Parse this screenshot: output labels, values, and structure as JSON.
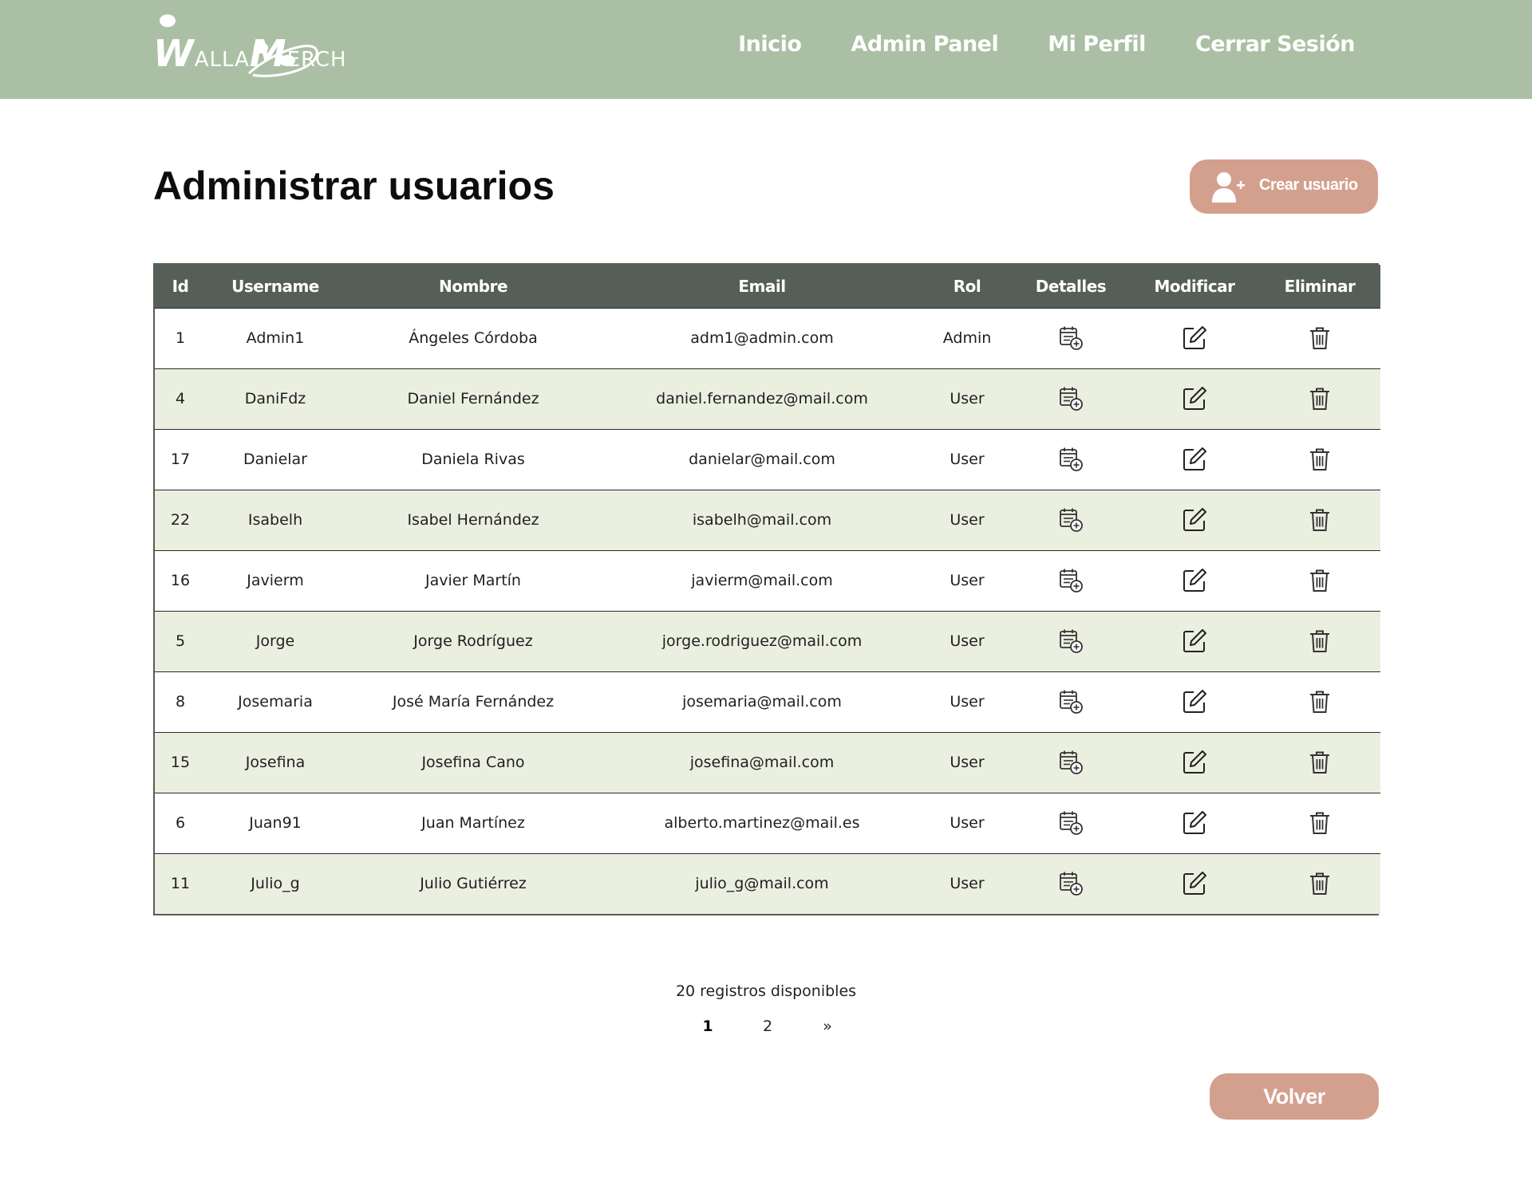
{
  "nav": {
    "logo_big_w": "W",
    "logo_alla": "ALLA",
    "logo_big_m": "M",
    "logo_erch": "ERCH",
    "links": [
      "Inicio",
      "Admin Panel",
      "Mi Perfil",
      "Cerrar Sesión"
    ]
  },
  "page": {
    "title": "Administrar usuarios",
    "create_button": "Crear usuario"
  },
  "table": {
    "headers": [
      "Id",
      "Username",
      "Nombre",
      "Email",
      "Rol",
      "Detalles",
      "Modificar",
      "Eliminar"
    ],
    "rows": [
      {
        "id": "1",
        "username": "Admin1",
        "nombre": "Ángeles Córdoba",
        "email": "adm1@admin.com",
        "rol": "Admin"
      },
      {
        "id": "4",
        "username": "DaniFdz",
        "nombre": "Daniel Fernández",
        "email": "daniel.fernandez@mail.com",
        "rol": "User"
      },
      {
        "id": "17",
        "username": "Danielar",
        "nombre": "Daniela Rivas",
        "email": "danielar@mail.com",
        "rol": "User"
      },
      {
        "id": "22",
        "username": "Isabelh",
        "nombre": "Isabel Hernández",
        "email": "isabelh@mail.com",
        "rol": "User"
      },
      {
        "id": "16",
        "username": "Javierm",
        "nombre": "Javier Martín",
        "email": "javierm@mail.com",
        "rol": "User"
      },
      {
        "id": "5",
        "username": "Jorge",
        "nombre": "Jorge Rodríguez",
        "email": "jorge.rodriguez@mail.com",
        "rol": "User"
      },
      {
        "id": "8",
        "username": "Josemaria",
        "nombre": "José María Fernández",
        "email": "josemaria@mail.com",
        "rol": "User"
      },
      {
        "id": "15",
        "username": "Josefina",
        "nombre": "Josefina Cano",
        "email": "josefina@mail.com",
        "rol": "User"
      },
      {
        "id": "6",
        "username": "Juan91",
        "nombre": "Juan Martínez",
        "email": "alberto.martinez@mail.es",
        "rol": "User"
      },
      {
        "id": "11",
        "username": "Julio_g",
        "nombre": "Julio Gutiérrez",
        "email": "julio_g@mail.com",
        "rol": "User"
      }
    ]
  },
  "footer": {
    "records_text": "20 registros disponibles",
    "pages": [
      "1",
      "2",
      "»"
    ],
    "active_page": "1",
    "back_button": "Volver"
  },
  "icons": {
    "create": "user-plus-icon",
    "details": "calendar-add-icon",
    "edit": "edit-pencil-icon",
    "delete": "trash-icon"
  },
  "colors": {
    "navbar": "#abbfa4",
    "table_header": "#565e58",
    "row_alt": "#ebefe0",
    "accent_button": "#d4a08e"
  }
}
